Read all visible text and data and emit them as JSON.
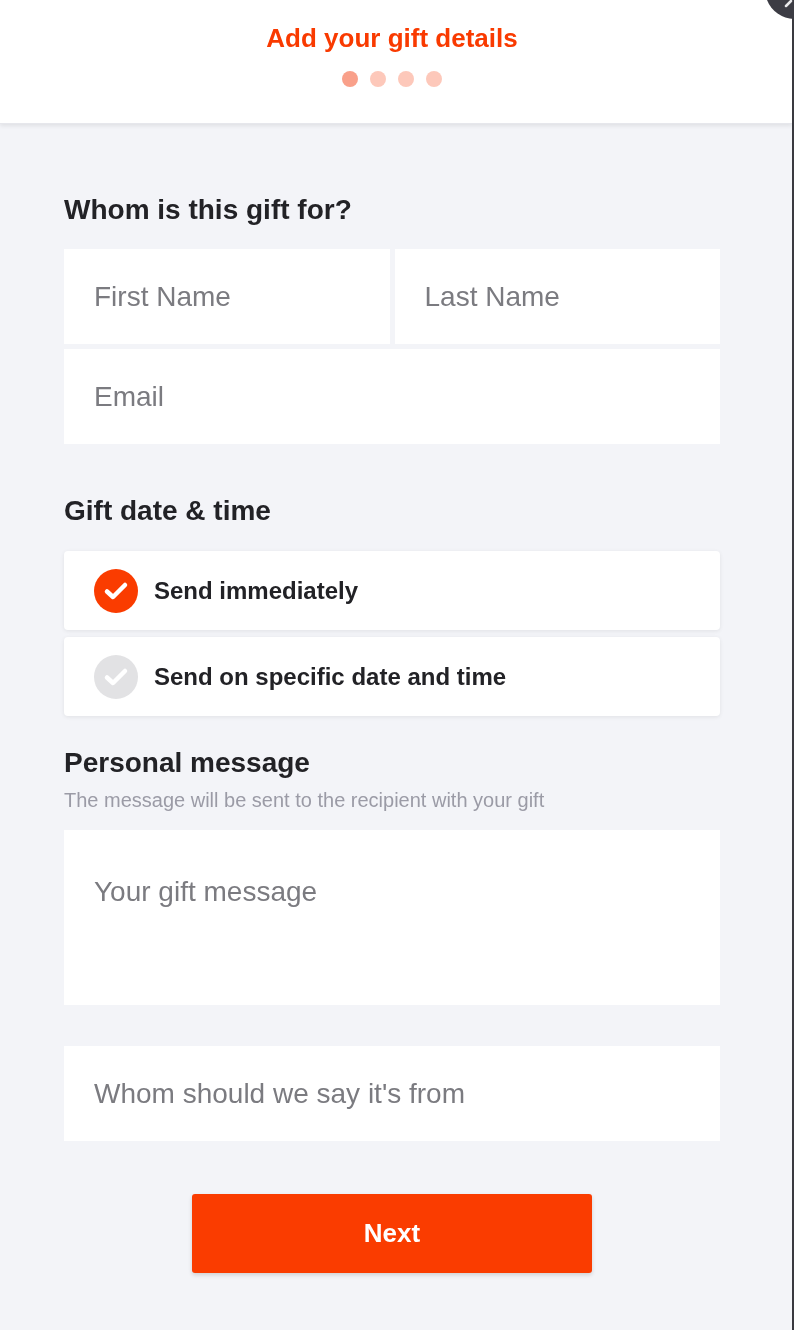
{
  "header": {
    "title": "Add your gift details",
    "steps": [
      {
        "selected": true
      },
      {
        "selected": false
      },
      {
        "selected": false
      },
      {
        "selected": false
      }
    ]
  },
  "recipient": {
    "heading": "Whom is this gift for?",
    "fields": [
      {
        "placeholder": "First Name"
      },
      {
        "placeholder": "Last Name"
      },
      {
        "placeholder": "Email"
      }
    ]
  },
  "schedule": {
    "heading": "Gift date & time",
    "options": [
      {
        "label": "Send immediately",
        "selected": true
      },
      {
        "label": "Send on specific date and time",
        "selected": false
      }
    ]
  },
  "message": {
    "heading": "Personal message",
    "hint": "The message will be sent to the recipient with your gift",
    "field": {
      "placeholder": "Your gift message"
    }
  },
  "sender_field": {
    "placeholder": "Whom should we say it's from"
  },
  "next_button": {
    "label": "Next"
  }
}
